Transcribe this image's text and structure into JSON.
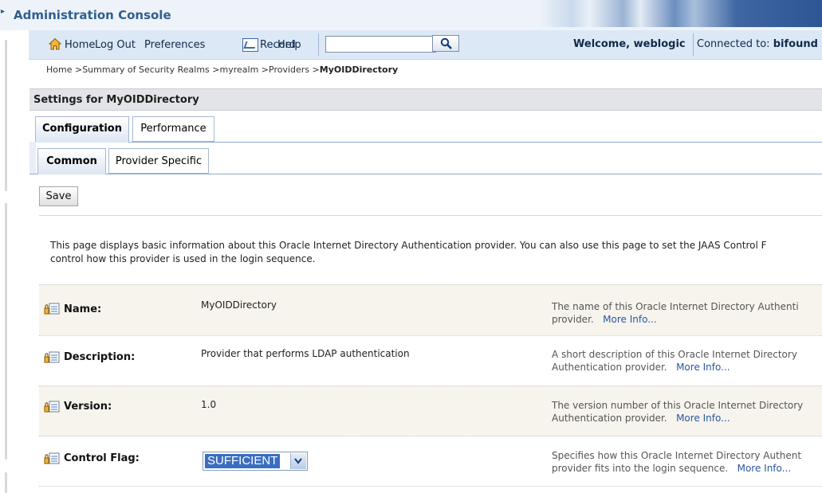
{
  "app": {
    "title": "Administration Console"
  },
  "toolbar": {
    "home_label": "Home",
    "logout_label": "Log Out",
    "preferences_label": "Preferences",
    "record_label": "Record",
    "help_label": "Help",
    "search_value": "",
    "welcome_text": "Welcome, weblogic",
    "connected_prefix": "Connected to:",
    "connected_server": "bifound"
  },
  "breadcrumb": {
    "items": [
      "Home",
      "Summary of Security Realms",
      "myrealm",
      "Providers"
    ],
    "separator": " >",
    "current": "MyOIDDirectory"
  },
  "settings": {
    "title": "Settings for MyOIDDirectory"
  },
  "tabs": {
    "primary": [
      {
        "label": "Configuration",
        "active": true
      },
      {
        "label": "Performance",
        "active": false
      }
    ],
    "secondary": [
      {
        "label": "Common",
        "active": true
      },
      {
        "label": "Provider Specific",
        "active": false
      }
    ]
  },
  "actions": {
    "save_label": "Save"
  },
  "intro": {
    "line1": "This page displays basic information about this Oracle Internet Directory Authentication provider. You can also use this page to set the JAAS Control F",
    "line2": "control how this provider is used in the login sequence."
  },
  "fields": [
    {
      "label": "Name:",
      "value": "MyOIDDirectory",
      "help1": "The name of this Oracle Internet Directory Authenti",
      "help2": "provider.",
      "more": "More Info..."
    },
    {
      "label": "Description:",
      "value": "Provider that performs LDAP authentication",
      "help1": "A short description of this Oracle Internet Directory",
      "help2": "Authentication provider.",
      "more": "More Info..."
    },
    {
      "label": "Version:",
      "value": "1.0",
      "help1": "The version number of this Oracle Internet Directory",
      "help2": "Authentication provider.",
      "more": "More Info..."
    },
    {
      "label": "Control Flag:",
      "value": "SUFFICIENT",
      "help1": "Specifies how this Oracle Internet Directory Authent",
      "help2": "provider fits into the login sequence.",
      "more": "More Info..."
    }
  ],
  "colors": {
    "title": "#2f5f8f",
    "toolbar_bg": "#dde8f6",
    "link": "#2b55a3",
    "select_highlight": "#3a6ec0"
  },
  "icons": [
    "home-icon",
    "record-icon",
    "search-icon",
    "lock-edit-icon",
    "chevron-down-icon"
  ]
}
